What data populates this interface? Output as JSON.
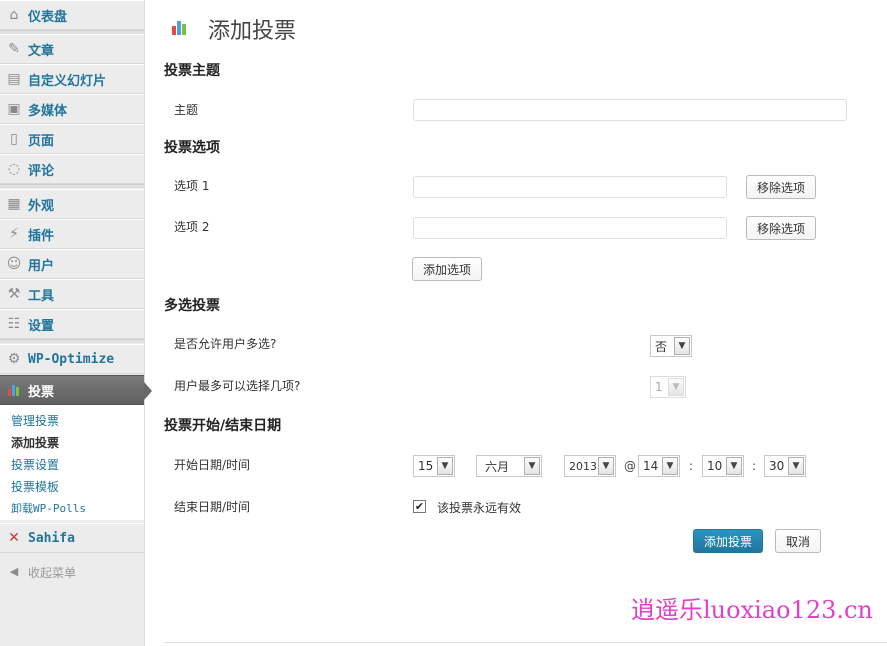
{
  "sidebar": {
    "dashboard": "仪表盘",
    "posts": "文章",
    "slides": "自定义幻灯片",
    "media": "多媒体",
    "pages": "页面",
    "comments": "评论",
    "appearance": "外观",
    "plugins": "插件",
    "users": "用户",
    "tools": "工具",
    "settings": "设置",
    "wp_optimize": "WP-Optimize",
    "polls": "投票",
    "polls_submenu": [
      "管理投票",
      "添加投票",
      "投票设置",
      "投票模板",
      "卸载WP-Polls"
    ],
    "sahifa": "Sahifa",
    "collapse": "收起菜单"
  },
  "page": {
    "title": "添加投票",
    "section_subject": "投票主题",
    "label_subject": "主题",
    "subject_value": "",
    "section_options": "投票选项",
    "option_1_label": "选项 1",
    "option_2_label": "选项 2",
    "remove_option": "移除选项",
    "add_option": "添加选项",
    "section_multi": "多选投票",
    "allow_multi_label": "是否允许用户多选?",
    "allow_multi_value": "否",
    "max_choices_label": "用户最多可以选择几项?",
    "max_choices_value": "1",
    "section_dates": "投票开始/结束日期",
    "start_label": "开始日期/时间",
    "start_day": "15",
    "start_month": "六月",
    "start_year": "2013",
    "at_sign": "@",
    "start_hour": "14",
    "start_minute": "10",
    "start_second": "30",
    "colon": ":",
    "end_label": "结束日期/时间",
    "never_expire_label": "该投票永远有效",
    "never_expire_checked": "✔",
    "submit_button": "添加投票",
    "cancel_button": "取消"
  },
  "watermark": "逍遥乐luoxiao123.cn",
  "colors": {
    "link": "#21759b",
    "primary_button": "#21759b",
    "watermark": "#e43fc8"
  }
}
